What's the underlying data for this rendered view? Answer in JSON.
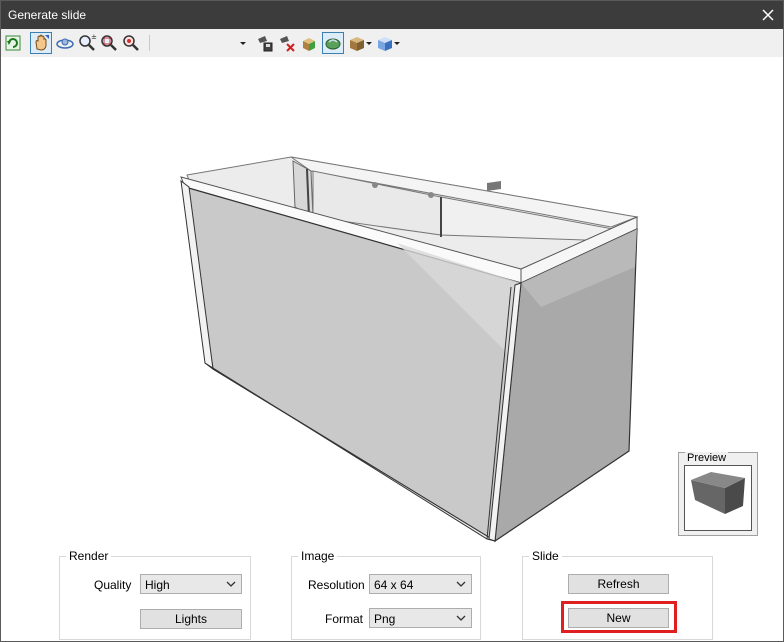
{
  "window": {
    "title": "Generate slide"
  },
  "toolbar": {
    "icons": [
      "refresh-view-icon",
      "pan-hand-icon",
      "orbit-icon",
      "zoom-icon",
      "zoom-extents-icon",
      "zoom-window-icon",
      "camera-save-icon",
      "camera-delete-icon",
      "paint-icon",
      "shaded-icon",
      "box-display-icon",
      "view-cube-icon"
    ]
  },
  "preview": {
    "label": "Preview"
  },
  "render": {
    "label": "Render",
    "quality_label": "Quality",
    "quality_value": "High",
    "lights_button": "Lights"
  },
  "image": {
    "label": "Image",
    "resolution_label": "Resolution",
    "resolution_value": "64 x 64",
    "format_label": "Format",
    "format_value": "Png"
  },
  "slide": {
    "label": "Slide",
    "refresh_button": "Refresh",
    "new_button": "New"
  },
  "colors": {
    "highlight": "#e02020",
    "titlebar": "#3c3c3c"
  }
}
